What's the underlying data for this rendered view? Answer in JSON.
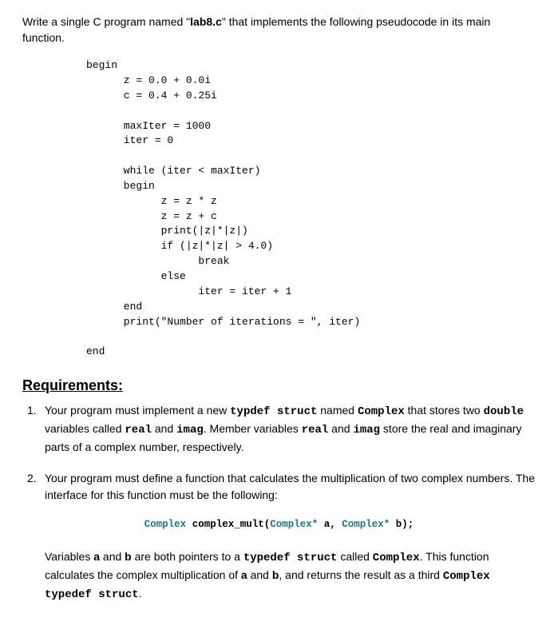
{
  "intro": {
    "part1": "Write a single C program named \"",
    "filename": "lab8.c",
    "part2": "\" that implements the following pseudocode in its main function."
  },
  "code": "begin\n      z = 0.0 + 0.0i\n      c = 0.4 + 0.25i\n\n      maxIter = 1000\n      iter = 0\n\n      while (iter < maxIter)\n      begin\n            z = z * z\n            z = z + c\n            print(|z|*|z|)\n            if (|z|*|z| > 4.0)\n                  break\n            else\n                  iter = iter + 1\n      end\n      print(\"Number of iterations = \", iter)\n\nend",
  "requirements_heading": "Requirements:",
  "requirements": [
    {
      "num": "1.",
      "parts": [
        {
          "t": "Your program must implement a new "
        },
        {
          "t": "typdef struct",
          "mono": true
        },
        {
          "t": " named "
        },
        {
          "t": "Complex",
          "mono": true
        },
        {
          "t": " that stores two "
        },
        {
          "t": "double",
          "mono": true
        },
        {
          "t": " variables called "
        },
        {
          "t": "real",
          "mono": true
        },
        {
          "t": " and "
        },
        {
          "t": "imag",
          "mono": true
        },
        {
          "t": ". Member variables "
        },
        {
          "t": "real",
          "mono": true
        },
        {
          "t": " and "
        },
        {
          "t": "imag",
          "mono": true
        },
        {
          "t": " store the real and imaginary parts of a complex number, respectively."
        }
      ]
    },
    {
      "num": "2.",
      "parts": [
        {
          "t": "Your program must define a function that calculates the multiplication of two complex numbers. The interface for this function must be the following:"
        }
      ]
    }
  ],
  "func_sig": {
    "ret_type": "Complex ",
    "name": "complex_mult",
    "paren_open": "(",
    "p1_type": "Complex*",
    "p1_name": " a",
    "comma": ", ",
    "p2_type": "Complex*",
    "p2_name": " b",
    "paren_close": ");"
  },
  "continuation": {
    "parts": [
      {
        "t": "Variables "
      },
      {
        "t": "a",
        "bold": true
      },
      {
        "t": " and "
      },
      {
        "t": "b",
        "bold": true
      },
      {
        "t": " are both pointers to a "
      },
      {
        "t": "typedef struct",
        "mono": true
      },
      {
        "t": " called "
      },
      {
        "t": "Complex",
        "mono": true
      },
      {
        "t": ". This function calculates the complex multiplication of "
      },
      {
        "t": "a",
        "bold": true
      },
      {
        "t": " and "
      },
      {
        "t": "b",
        "bold": true
      },
      {
        "t": ", and returns the result as a third "
      },
      {
        "t": "Complex typedef struct",
        "mono": true
      },
      {
        "t": "."
      }
    ]
  }
}
